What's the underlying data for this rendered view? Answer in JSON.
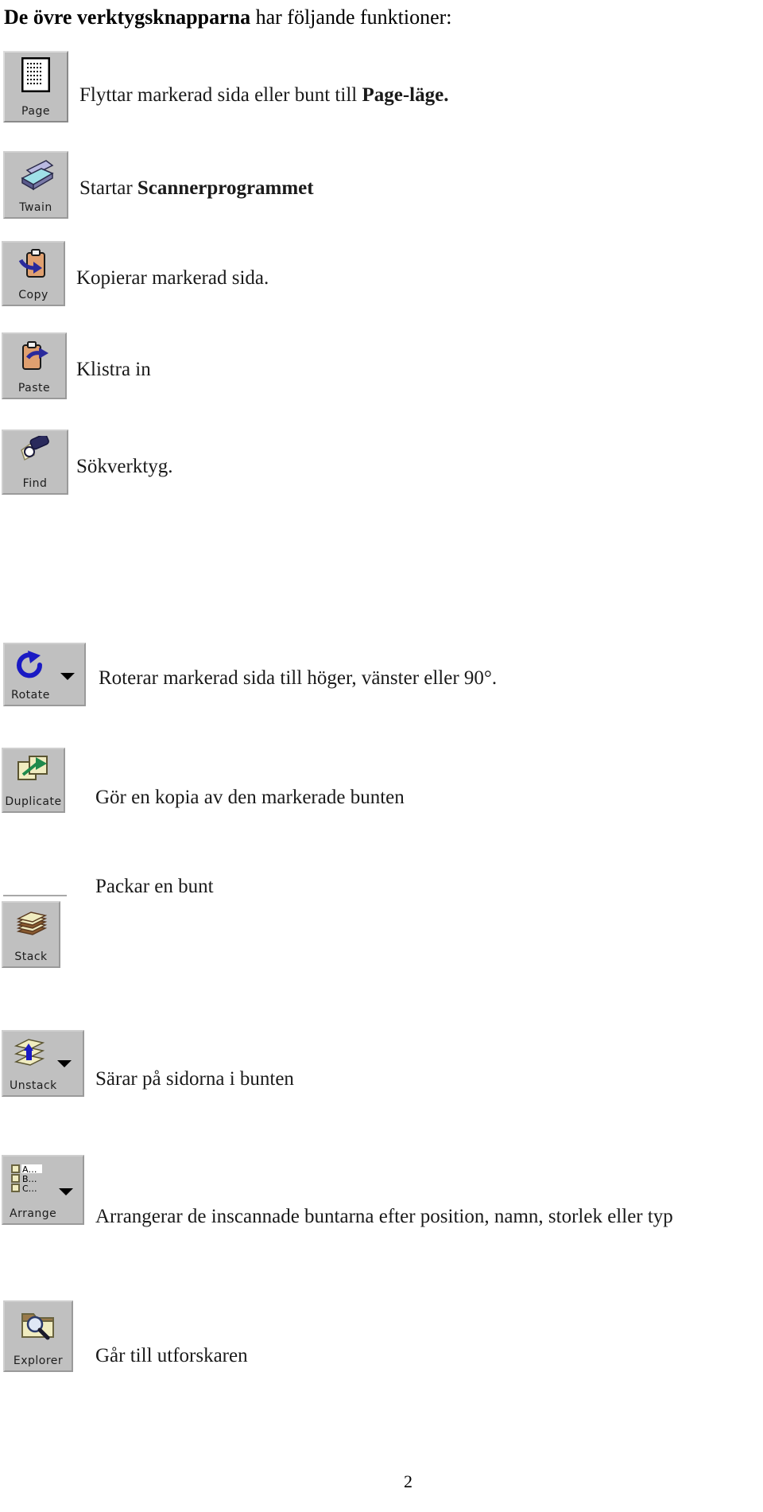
{
  "document": {
    "heading_bold": "De övre verktygsknapparna",
    "heading_rest": " har följande funktioner:",
    "page_number": "2"
  },
  "toolbar_rows": [
    {
      "button_label": "Page",
      "icon": "page-document-icon",
      "has_dropdown": false,
      "desc_plain": "Flyttar markerad sida eller bunt till ",
      "desc_bold": "Page-läge."
    },
    {
      "button_label": "Twain",
      "icon": "scanner-icon",
      "has_dropdown": false,
      "desc_plain": "Startar ",
      "desc_bold": "Scannerprogrammet"
    },
    {
      "button_label": "Copy",
      "icon": "clipboard-copy-icon",
      "has_dropdown": false,
      "desc_plain": "Kopierar markerad sida.",
      "desc_bold": ""
    },
    {
      "button_label": "Paste",
      "icon": "clipboard-paste-icon",
      "has_dropdown": false,
      "desc_plain": "Klistra in",
      "desc_bold": ""
    },
    {
      "button_label": "Find",
      "icon": "flashlight-find-icon",
      "has_dropdown": false,
      "desc_plain": "Sökverktyg.",
      "desc_bold": ""
    },
    {
      "button_label": "Rotate",
      "icon": "rotate-arrow-icon",
      "has_dropdown": true,
      "desc_plain": "Roterar markerad sida till höger, vänster eller 90°.",
      "desc_bold": ""
    },
    {
      "button_label": "Duplicate",
      "icon": "duplicate-pages-icon",
      "has_dropdown": false,
      "desc_plain": "Gör en kopia av den markerade bunten",
      "desc_bold": ""
    },
    {
      "button_label": "Stack",
      "icon": "stack-papers-icon",
      "has_dropdown": false,
      "desc_plain": "Packar en bunt",
      "desc_bold": ""
    },
    {
      "button_label": "Unstack",
      "icon": "unstack-sheets-icon",
      "has_dropdown": true,
      "desc_plain": "Särar på sidorna i bunten",
      "desc_bold": ""
    },
    {
      "button_label": "Arrange",
      "icon": "arrange-list-icon",
      "has_dropdown": true,
      "desc_plain": "Arrangerar de inscannade buntarna efter position, namn, storlek eller typ",
      "desc_bold": ""
    },
    {
      "button_label": "Explorer",
      "icon": "folder-search-icon",
      "has_dropdown": false,
      "desc_plain": "Går till utforskaren",
      "desc_bold": ""
    }
  ],
  "colors": {
    "button_face": "#c0c0c0",
    "clipboard": "#e0a070",
    "paper_yellow": "#f0ecc0",
    "arrow_blue": "#2a2a9c",
    "arrow_green": "#1f8a4c",
    "scanner_body": "#6a6a9c"
  }
}
